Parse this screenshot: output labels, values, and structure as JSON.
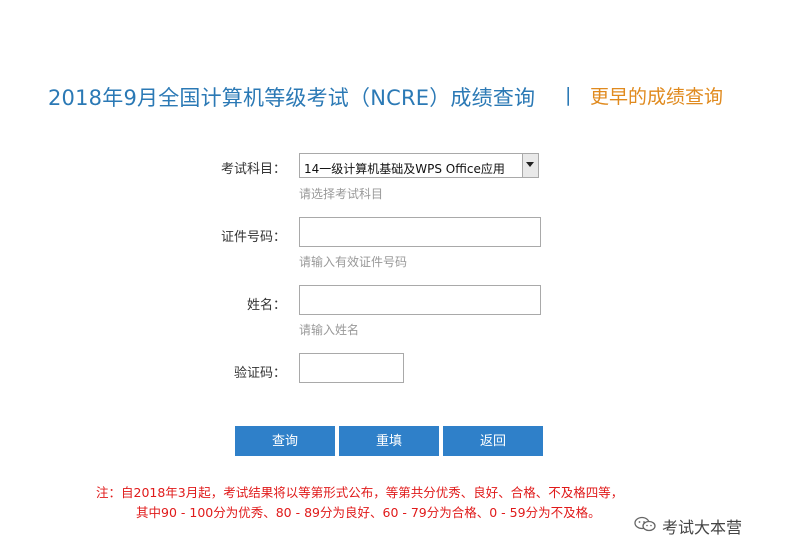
{
  "header": {
    "title": "2018年9月全国计算机等级考试（NCRE）成绩查询",
    "separator": "|",
    "earlier_link": "更早的成绩查询"
  },
  "form": {
    "subject": {
      "label": "考试科目：",
      "selected": "14一级计算机基础及WPS Office应用",
      "hint": "请选择考试科目"
    },
    "id_number": {
      "label": "证件号码：",
      "value": "",
      "hint": "请输入有效证件号码"
    },
    "name": {
      "label": "姓名：",
      "value": "",
      "hint": "请输入姓名"
    },
    "captcha": {
      "label": "验证码：",
      "value": ""
    }
  },
  "buttons": {
    "query": "查询",
    "reset": "重填",
    "back": "返回"
  },
  "notice": {
    "line1": "注：自2018年3月起，考试结果将以等第形式公布，等第共分优秀、良好、合格、不及格四等，",
    "line2": "其中90 - 100分为优秀、80 - 89分为良好、60 - 79分为合格、0 - 59分为不及格。"
  },
  "watermark": {
    "text": "考试大本营",
    "icon": "wechat-icon"
  },
  "colors": {
    "title": "#2b79b5",
    "link": "#e08a1e",
    "button": "#2f80c9",
    "notice": "#e01a1a",
    "hint": "#999999"
  }
}
